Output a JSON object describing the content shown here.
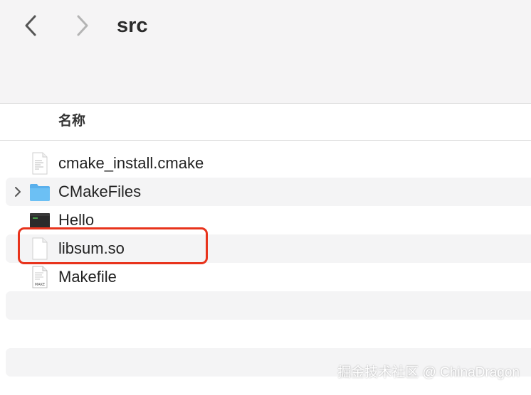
{
  "window": {
    "title": "src"
  },
  "navigation": {
    "back_icon": "chevron-left-icon",
    "forward_icon": "chevron-right-icon"
  },
  "columns": {
    "name": "名称"
  },
  "files": [
    {
      "name": "cmake_install.cmake",
      "icon": "document-icon",
      "kind": "file"
    },
    {
      "name": "CMakeFiles",
      "icon": "folder-icon",
      "kind": "folder",
      "collapsed": true
    },
    {
      "name": "Hello",
      "icon": "executable-icon",
      "kind": "executable"
    },
    {
      "name": "libsum.so",
      "icon": "blank-document-icon",
      "kind": "file",
      "highlighted": true
    },
    {
      "name": "Makefile",
      "icon": "makefile-icon",
      "kind": "file",
      "icon_text": "MAKE"
    }
  ],
  "annotation": {
    "highlight_color": "#e8331c"
  },
  "watermark": "掘金技术社区 @ ChinaDragon",
  "colors": {
    "folder": "#5ab0ec",
    "toolbar_bg": "#f5f4f5",
    "alt_row_bg": "#f4f4f5"
  }
}
